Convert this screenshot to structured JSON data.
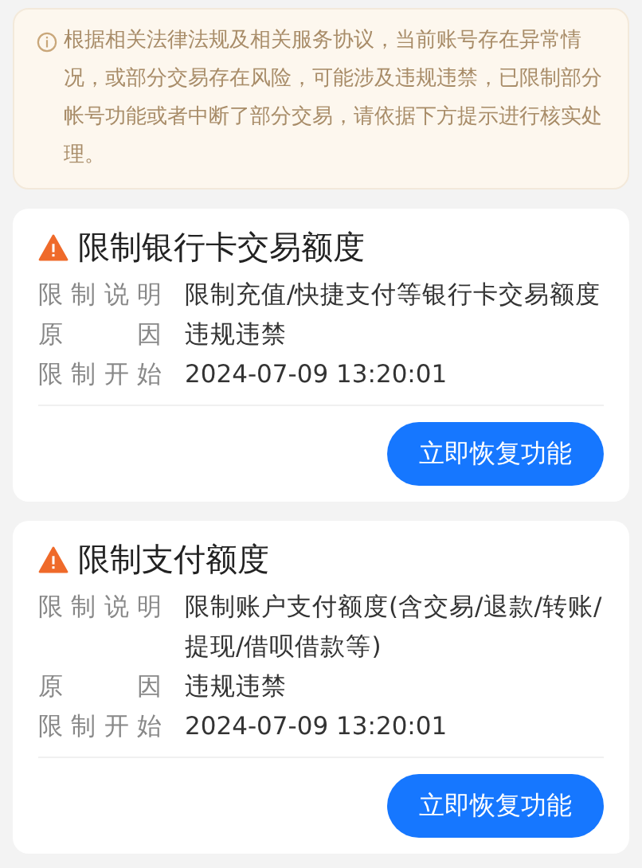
{
  "notice": {
    "text": "根据相关法律法规及相关服务协议，当前账号存在异常情况，或部分交易存在风险，可能涉及违规违禁，已限制部分帐号功能或者中断了部分交易，请依据下方提示进行核实处理。"
  },
  "restrictions": [
    {
      "title": "限制银行卡交易额度",
      "rows": [
        {
          "label": "限制说明",
          "value": "限制充值/快捷支付等银行卡交易额度"
        },
        {
          "label": "原因",
          "value": "违规违禁"
        },
        {
          "label": "限制开始",
          "value": "2024-07-09 13:20:01"
        }
      ],
      "button": "立即恢复功能"
    },
    {
      "title": "限制支付额度",
      "rows": [
        {
          "label": "限制说明",
          "value": "限制账户支付额度(含交易/退款/转账/提现/借呗借款等)"
        },
        {
          "label": "原因",
          "value": "违规违禁"
        },
        {
          "label": "限制开始",
          "value": "2024-07-09 13:20:01"
        }
      ],
      "button": "立即恢复功能"
    }
  ]
}
